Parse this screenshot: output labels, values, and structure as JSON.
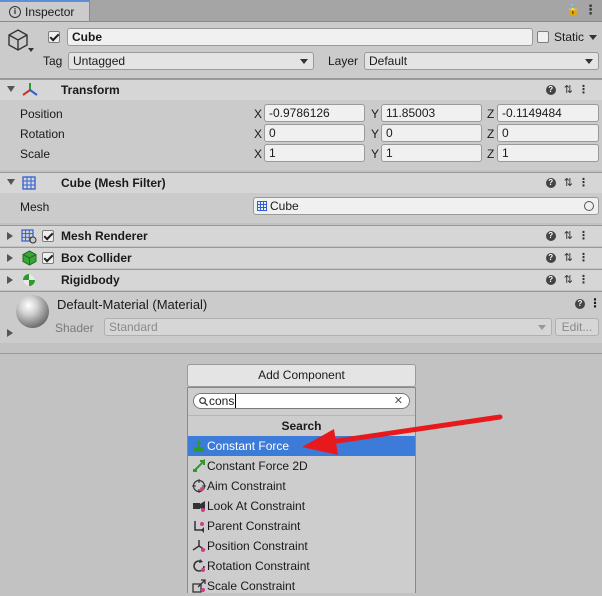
{
  "tab": {
    "title": "Inspector"
  },
  "object": {
    "name": "Cube",
    "static_label": "Static",
    "tag_label": "Tag",
    "tag_value": "Untagged",
    "layer_label": "Layer",
    "layer_value": "Default"
  },
  "transform": {
    "title": "Transform",
    "rows": [
      {
        "label": "Position",
        "x": "-0.9786126",
        "y": "11.85003",
        "z": "-0.1149484"
      },
      {
        "label": "Rotation",
        "x": "0",
        "y": "0",
        "z": "0"
      },
      {
        "label": "Scale",
        "x": "1",
        "y": "1",
        "z": "1"
      }
    ],
    "axes": {
      "x": "X",
      "y": "Y",
      "z": "Z"
    }
  },
  "mesh_filter": {
    "title": "Cube (Mesh Filter)",
    "mesh_label": "Mesh",
    "mesh_value": "Cube"
  },
  "mesh_renderer": {
    "title": "Mesh Renderer"
  },
  "box_collider": {
    "title": "Box Collider"
  },
  "rigidbody": {
    "title": "Rigidbody"
  },
  "material": {
    "title": "Default-Material (Material)",
    "shader_label": "Shader",
    "shader_value": "Standard",
    "edit_label": "Edit..."
  },
  "add_component": {
    "button_label": "Add Component",
    "search_value": "cons",
    "section_title": "Search",
    "items": [
      {
        "label": "Constant Force",
        "icon": "constant-force-icon"
      },
      {
        "label": "Constant Force 2D",
        "icon": "constant-force-2d-icon"
      },
      {
        "label": "Aim Constraint",
        "icon": "aim-constraint-icon"
      },
      {
        "label": "Look At Constraint",
        "icon": "look-at-constraint-icon"
      },
      {
        "label": "Parent Constraint",
        "icon": "parent-constraint-icon"
      },
      {
        "label": "Position Constraint",
        "icon": "position-constraint-icon"
      },
      {
        "label": "Rotation Constraint",
        "icon": "rotation-constraint-icon"
      },
      {
        "label": "Scale Constraint",
        "icon": "scale-constraint-icon"
      }
    ]
  },
  "colors": {
    "selection": "#3d7bd9",
    "arrow": "#e8191c",
    "panel": "#cbcbcb"
  }
}
